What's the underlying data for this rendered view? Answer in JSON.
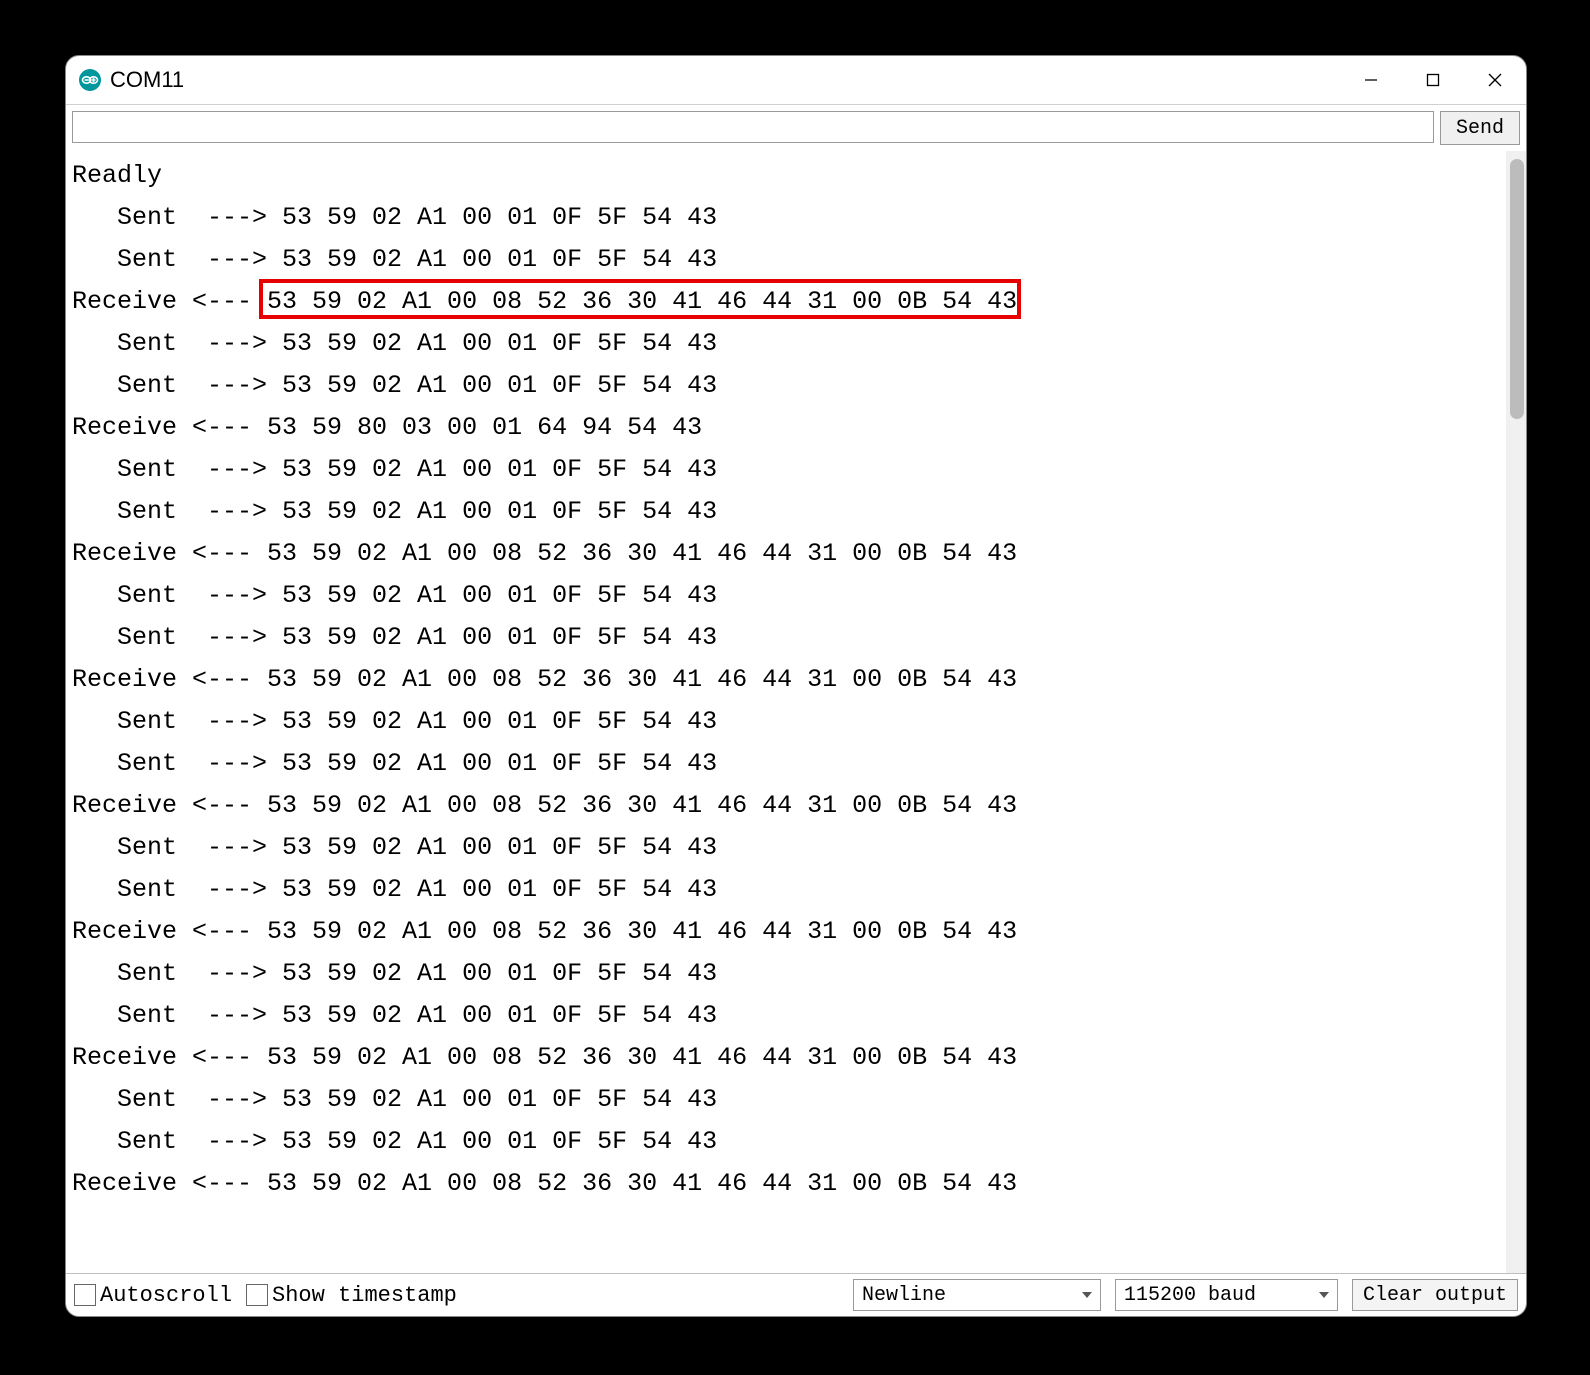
{
  "window": {
    "title": "COM11"
  },
  "input": {
    "value": "",
    "send_label": "Send"
  },
  "console_lines": [
    {
      "text": "Readly",
      "highlighted": false
    },
    {
      "text": "   Sent  ---> 53 59 02 A1 00 01 0F 5F 54 43",
      "highlighted": false
    },
    {
      "text": "   Sent  ---> 53 59 02 A1 00 01 0F 5F 54 43",
      "highlighted": false
    },
    {
      "text": "Receive <--- 53 59 02 A1 00 08 52 36 30 41 46 44 31 00 0B 54 43",
      "highlighted": true
    },
    {
      "text": "   Sent  ---> 53 59 02 A1 00 01 0F 5F 54 43",
      "highlighted": false
    },
    {
      "text": "   Sent  ---> 53 59 02 A1 00 01 0F 5F 54 43",
      "highlighted": false
    },
    {
      "text": "Receive <--- 53 59 80 03 00 01 64 94 54 43",
      "highlighted": false
    },
    {
      "text": "   Sent  ---> 53 59 02 A1 00 01 0F 5F 54 43",
      "highlighted": false
    },
    {
      "text": "   Sent  ---> 53 59 02 A1 00 01 0F 5F 54 43",
      "highlighted": false
    },
    {
      "text": "Receive <--- 53 59 02 A1 00 08 52 36 30 41 46 44 31 00 0B 54 43",
      "highlighted": false
    },
    {
      "text": "   Sent  ---> 53 59 02 A1 00 01 0F 5F 54 43",
      "highlighted": false
    },
    {
      "text": "   Sent  ---> 53 59 02 A1 00 01 0F 5F 54 43",
      "highlighted": false
    },
    {
      "text": "Receive <--- 53 59 02 A1 00 08 52 36 30 41 46 44 31 00 0B 54 43",
      "highlighted": false
    },
    {
      "text": "   Sent  ---> 53 59 02 A1 00 01 0F 5F 54 43",
      "highlighted": false
    },
    {
      "text": "   Sent  ---> 53 59 02 A1 00 01 0F 5F 54 43",
      "highlighted": false
    },
    {
      "text": "Receive <--- 53 59 02 A1 00 08 52 36 30 41 46 44 31 00 0B 54 43",
      "highlighted": false
    },
    {
      "text": "   Sent  ---> 53 59 02 A1 00 01 0F 5F 54 43",
      "highlighted": false
    },
    {
      "text": "   Sent  ---> 53 59 02 A1 00 01 0F 5F 54 43",
      "highlighted": false
    },
    {
      "text": "Receive <--- 53 59 02 A1 00 08 52 36 30 41 46 44 31 00 0B 54 43",
      "highlighted": false
    },
    {
      "text": "   Sent  ---> 53 59 02 A1 00 01 0F 5F 54 43",
      "highlighted": false
    },
    {
      "text": "   Sent  ---> 53 59 02 A1 00 01 0F 5F 54 43",
      "highlighted": false
    },
    {
      "text": "Receive <--- 53 59 02 A1 00 08 52 36 30 41 46 44 31 00 0B 54 43",
      "highlighted": false
    },
    {
      "text": "   Sent  ---> 53 59 02 A1 00 01 0F 5F 54 43",
      "highlighted": false
    },
    {
      "text": "   Sent  ---> 53 59 02 A1 00 01 0F 5F 54 43",
      "highlighted": false
    },
    {
      "text": "Receive <--- 53 59 02 A1 00 08 52 36 30 41 46 44 31 00 0B 54 43",
      "highlighted": false
    }
  ],
  "bottom": {
    "autoscroll_label": "Autoscroll",
    "autoscroll_checked": false,
    "show_timestamp_label": "Show timestamp",
    "show_timestamp_checked": false,
    "line_ending": "Newline",
    "baud_rate": "115200 baud",
    "clear_label": "Clear output"
  }
}
